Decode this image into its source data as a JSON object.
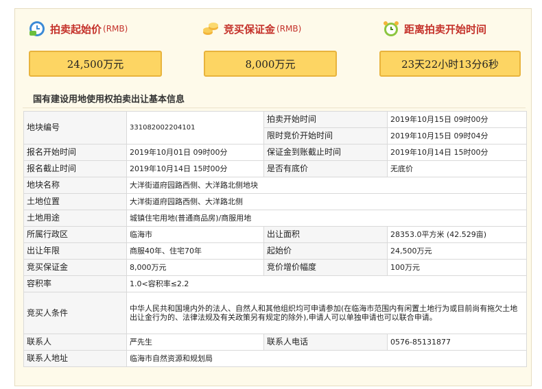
{
  "stats": {
    "starting_price": {
      "title": "拍卖起始价",
      "unit": "(RMB)",
      "value": "24,500万元",
      "icon": "money-clock-icon"
    },
    "deposit": {
      "title": "竞买保证金",
      "unit": "(RMB)",
      "value": "8,000万元",
      "icon": "coins-icon"
    },
    "countdown": {
      "title": "距离拍卖开始时间",
      "value": "23天22小时13分6秒",
      "icon": "alarm-clock-icon"
    }
  },
  "section_title": "国有建设用地使用权拍卖出让基本信息",
  "table": {
    "parcel_no_label": "地块编号",
    "parcel_no": "331082002204101",
    "auction_start_label": "拍卖开始时间",
    "auction_start": "2019年10月15日 09时00分",
    "bid_start_label": "限时竞价开始时间",
    "bid_start": "2019年10月15日 09时04分",
    "signup_start_label": "报名开始时间",
    "signup_start": "2019年10月01日 09时00分",
    "deposit_deadline_label": "保证金到账截止时间",
    "deposit_deadline": "2019年10月14日 15时00分",
    "signup_end_label": "报名截止时间",
    "signup_end": "2019年10月14日 15时00分",
    "reserve_label": "是否有底价",
    "reserve": "无底价",
    "name_label": "地块名称",
    "name": "大洋街道府园路西侧、大洋路北侧地块",
    "location_label": "土地位置",
    "location": "大洋街道府园路西侧、大洋路北侧",
    "use_label": "土地用途",
    "use": "城镇住宅用地(普通商品房)/商服用地",
    "district_label": "所属行政区",
    "district": "临海市",
    "area_label": "出让面积",
    "area": "28353.0平方米 (42.529亩)",
    "term_label": "出让年限",
    "term": "商服40年、住宅70年",
    "start_price_label": "起始价",
    "start_price": "24,500万元",
    "deposit_label": "竞买保证金",
    "deposit": "8,000万元",
    "increment_label": "竞价增价幅度",
    "increment": "100万元",
    "far_label": "容积率",
    "far": "1.0<容积率≤2.2",
    "conditions_label": "竞买人条件",
    "conditions": "中华人民共和国境内外的法人、自然人和其他组织均可申请参加(在临海市范围内有闲置土地行为或目前尚有拖欠土地出让金行为的、法律法规及有关政策另有规定的除外),申请人可以单独申请也可以联合申请。",
    "contact_label": "联系人",
    "contact": "严先生",
    "phone_label": "联系人电话",
    "phone": "0576-85131877",
    "address_label": "联系人地址",
    "address": "临海市自然资源和规划局"
  },
  "colors": {
    "accent_red": "#c4312a",
    "value_box": "#fdd563",
    "panel_bg": "#fefaea"
  }
}
